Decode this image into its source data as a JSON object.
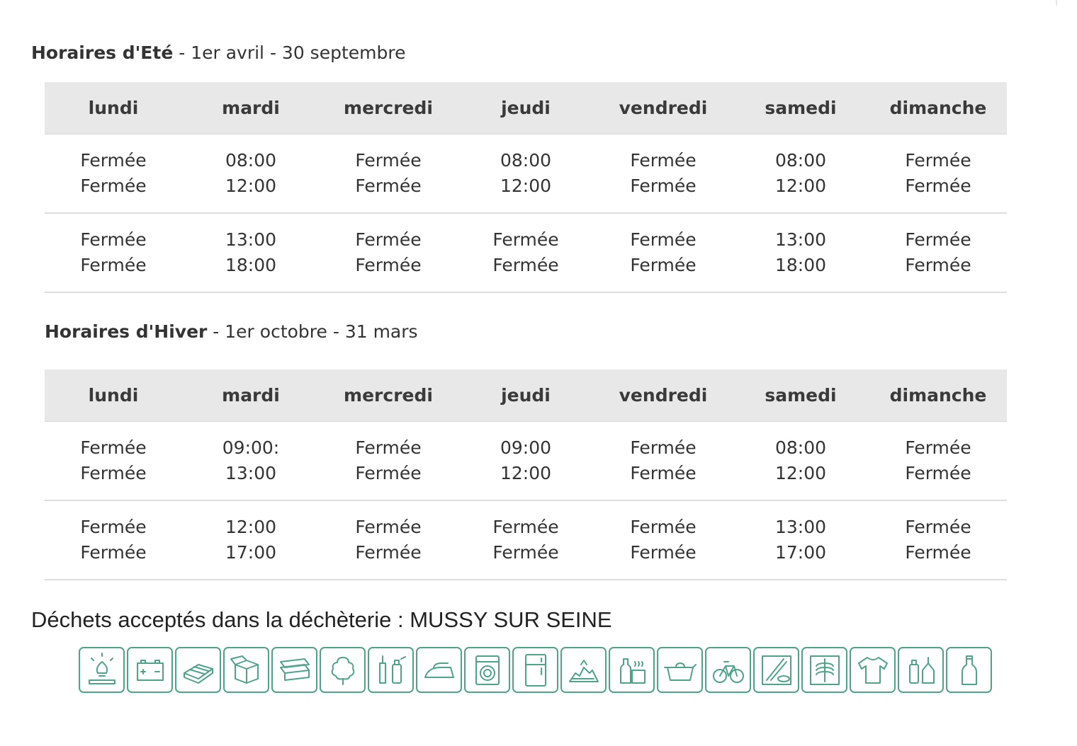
{
  "summer": {
    "title": "Horaires d'Eté",
    "period": " - 1er avril - 30 septembre",
    "days": [
      "lundi",
      "mardi",
      "mercredi",
      "jeudi",
      "vendredi",
      "samedi",
      "dimanche"
    ],
    "rows": [
      [
        [
          "Fermée",
          "Fermée"
        ],
        [
          "08:00",
          "12:00"
        ],
        [
          "Fermée",
          "Fermée"
        ],
        [
          "08:00",
          "12:00"
        ],
        [
          "Fermée",
          "Fermée"
        ],
        [
          "08:00",
          "12:00"
        ],
        [
          "Fermée",
          "Fermée"
        ]
      ],
      [
        [
          "Fermée",
          "Fermée"
        ],
        [
          "13:00",
          "18:00"
        ],
        [
          "Fermée",
          "Fermée"
        ],
        [
          "Fermée",
          "Fermée"
        ],
        [
          "Fermée",
          "Fermée"
        ],
        [
          "13:00",
          "18:00"
        ],
        [
          "Fermée",
          "Fermée"
        ]
      ]
    ]
  },
  "winter": {
    "title": "Horaires d'Hiver",
    "period": " - 1er octobre - 31 mars",
    "days": [
      "lundi",
      "mardi",
      "mercredi",
      "jeudi",
      "vendredi",
      "samedi",
      "dimanche"
    ],
    "rows": [
      [
        [
          "Fermée",
          "Fermée"
        ],
        [
          "09:00:",
          "13:00"
        ],
        [
          "Fermée",
          "Fermée"
        ],
        [
          "09:00",
          "12:00"
        ],
        [
          "Fermée",
          "Fermée"
        ],
        [
          "08:00",
          "12:00"
        ],
        [
          "Fermée",
          "Fermée"
        ]
      ],
      [
        [
          "Fermée",
          "Fermée"
        ],
        [
          "12:00",
          "17:00"
        ],
        [
          "Fermée",
          "Fermée"
        ],
        [
          "Fermée",
          "Fermée"
        ],
        [
          "Fermée",
          "Fermée"
        ],
        [
          "13:00",
          "17:00"
        ],
        [
          "Fermée",
          "Fermée"
        ]
      ]
    ]
  },
  "waste": {
    "title": "Déchets acceptés dans la déchèterie : MUSSY SUR SEINE",
    "icon_color": "#4ea487",
    "icons": [
      "light-bulb-icon",
      "battery-icon",
      "pallet-icon",
      "cardboard-box-icon",
      "wood-planks-icon",
      "green-waste-tree-icon",
      "paint-spray-icon",
      "iron-appliance-icon",
      "washing-machine-icon",
      "refrigerator-icon",
      "rubble-icon",
      "bottle-packaging-icon",
      "cooking-oil-pot-icon",
      "bicycle-metal-icon",
      "textile-neon-tube-icon",
      "x-ray-icon",
      "clothes-shirt-icon",
      "household-products-icon",
      "glass-bottle-icon"
    ]
  }
}
